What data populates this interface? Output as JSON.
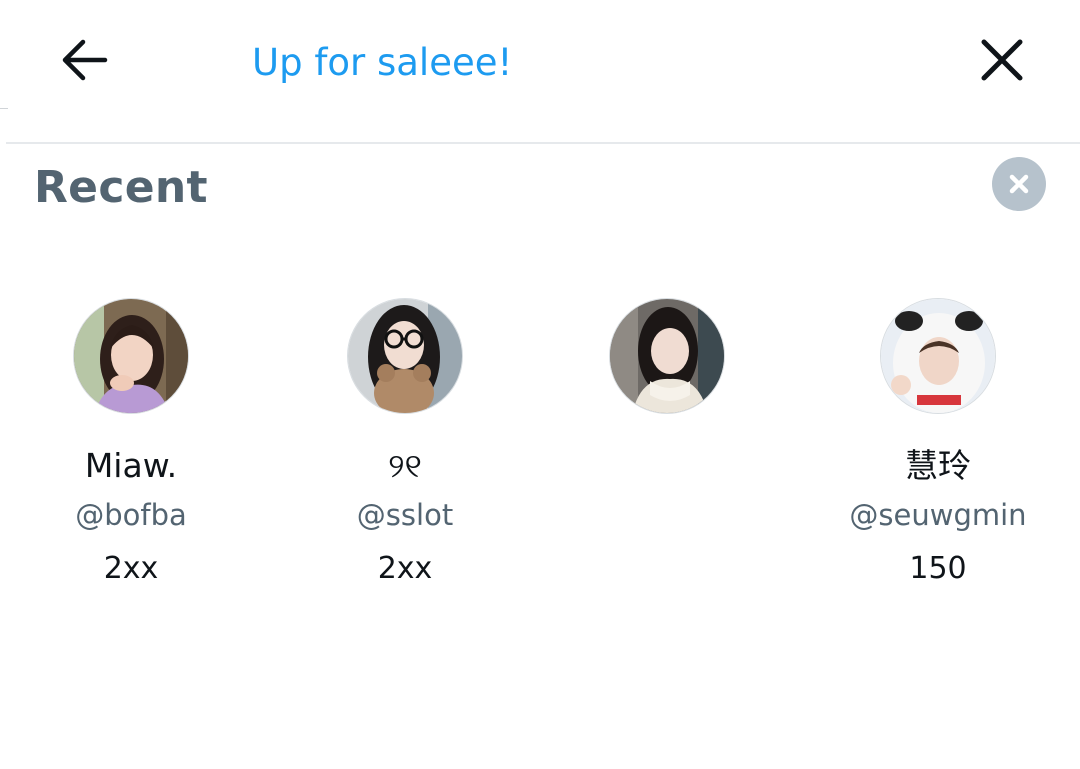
{
  "header": {
    "back_icon": "arrow-left-icon",
    "search_value": "Up for saleee!",
    "close_icon": "close-x-icon",
    "accent_color": "#1d9bf0"
  },
  "recent": {
    "title": "Recent",
    "clear_icon": "clear-x-icon",
    "users": [
      {
        "display_name": "Miaw.",
        "handle": "@bofba",
        "price": "2xx"
      },
      {
        "display_name": "୨୧",
        "handle": "@sslot",
        "price": "2xx"
      },
      {
        "display_name": "",
        "handle": "",
        "price": ""
      },
      {
        "display_name": "慧玲",
        "handle": "@seuwgmin",
        "price": "150"
      }
    ]
  }
}
